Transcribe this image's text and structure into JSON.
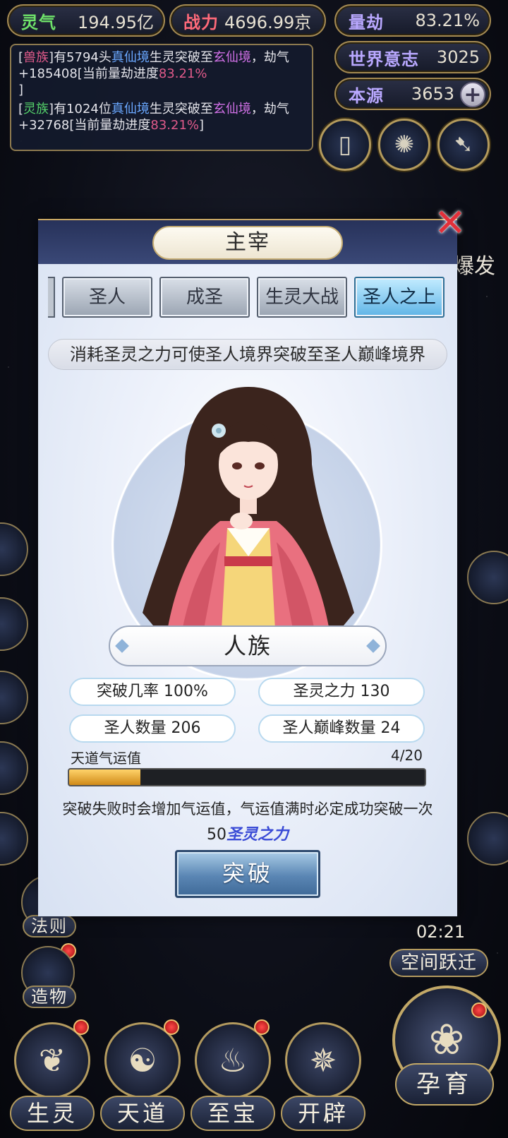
{
  "resources": {
    "lingqi": {
      "label": "灵气",
      "value": "194.95亿"
    },
    "zhanli": {
      "label": "战力",
      "value": "4696.99京"
    },
    "liangjie": {
      "label": "量劫",
      "value": "83.21%"
    },
    "shijie_yizhi": {
      "label": "世界意志",
      "value": "3025"
    },
    "benyuan": {
      "label": "本源",
      "value": "3653",
      "plus": "+"
    }
  },
  "log": {
    "line1": {
      "bracket_open": "[",
      "race": "兽族",
      "bracket_close": "]",
      "t1": "有5794头",
      "realm1": "真仙境",
      "t2": "生灵突破至",
      "realm2": "玄仙境",
      "t3": "，劫气+185408[当前量劫进度",
      "progress": "83.21%",
      "t4": "]"
    },
    "line2": {
      "bracket_open": "[",
      "race": "灵族",
      "bracket_close": "]",
      "t1": "有1024位",
      "realm1": "真仙境",
      "t2": "生灵突破至",
      "realm2": "玄仙境",
      "t3": "，劫气+32768[当前量劫进度",
      "progress": "83.21%",
      "t4": "]"
    }
  },
  "top_buttons": [
    {
      "icon": "card-icon",
      "glyph": "▯"
    },
    {
      "icon": "swirl-icon",
      "glyph": "✺"
    },
    {
      "icon": "feather-icon",
      "glyph": "➷"
    }
  ],
  "side_menu": {
    "burst": "爆发",
    "fa_ze": "法则",
    "zao_wu": "造物",
    "space_jump": {
      "timer": "02:21",
      "label": "空间跃迁"
    }
  },
  "bottom_nav": [
    {
      "label": "生灵",
      "icon": "spirit-icon",
      "glyph": "❦"
    },
    {
      "label": "天道",
      "icon": "heaven-icon",
      "glyph": "☯"
    },
    {
      "label": "至宝",
      "icon": "treasure-icon",
      "glyph": "♨"
    },
    {
      "label": "开辟",
      "icon": "create-icon",
      "glyph": "✵"
    },
    {
      "label": "孕育",
      "icon": "nurture-icon",
      "glyph": "❀"
    }
  ],
  "dialog": {
    "title": "主宰",
    "close": "✕",
    "tabs": [
      "圣人",
      "成圣",
      "生灵大战",
      "圣人之上"
    ],
    "active_tab": "圣人之上",
    "description": "消耗圣灵之力可使圣人境界突破至圣人巅峰境界",
    "race": "人族",
    "stats": {
      "break_rate": "突破几率 100%",
      "spirit_power": "圣灵之力 130",
      "sage_count": "圣人数量 206",
      "peak_count": "圣人巅峰数量 24"
    },
    "luck": {
      "label": "天道气运值",
      "current": 4,
      "max": 20,
      "display": "4/20"
    },
    "hint": "突破失败时会增加气运值，气运值满时必定成功突破一次",
    "cost": {
      "amount": "50",
      "resource": "圣灵之力"
    },
    "break_button": "突破"
  },
  "colors": {
    "gold_border": "#b49b5f",
    "active_tab": "#5fb4e6",
    "progress_fill": "#d08a18",
    "close_red": "#e3303a"
  }
}
